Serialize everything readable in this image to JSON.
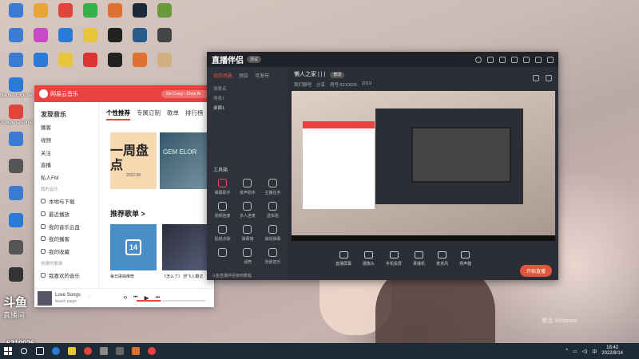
{
  "desktop": {
    "icons": [
      {
        "label": "",
        "color": "#3b7bd4"
      },
      {
        "label": "",
        "color": "#e8a53a"
      },
      {
        "label": "",
        "color": "#e0453a"
      },
      {
        "label": "",
        "color": "#34b24a"
      },
      {
        "label": "",
        "color": "#e07030"
      },
      {
        "label": "",
        "color": "#1b2838"
      },
      {
        "label": "",
        "color": "#6a9a3a"
      },
      {
        "label": "",
        "color": "#3b7bd4"
      },
      {
        "label": "",
        "color": "#c94ac9"
      },
      {
        "label": "",
        "color": "#2a7ad8"
      },
      {
        "label": "",
        "color": "#e8c53a"
      },
      {
        "label": "",
        "color": "#222"
      },
      {
        "label": "",
        "color": "#2a5a8a"
      },
      {
        "label": "",
        "color": "#444"
      },
      {
        "label": "",
        "color": "#3b7bd4"
      },
      {
        "label": "",
        "color": "#2a7ad8"
      },
      {
        "label": "",
        "color": "#e8c53a"
      },
      {
        "label": "",
        "color": "#d33"
      },
      {
        "label": "",
        "color": "#222"
      },
      {
        "label": "",
        "color": "#e07030"
      },
      {
        "label": "",
        "color": "#d0b080"
      },
      {
        "label": "Internet Explorer",
        "color": "#2a7ad8"
      },
      {
        "label": "Google Chrome",
        "color": "#e0453a"
      },
      {
        "label": "",
        "color": "#3b7bd4"
      },
      {
        "label": "",
        "color": "#555"
      },
      {
        "label": "",
        "color": "#3b7bd4"
      },
      {
        "label": "",
        "color": "#2a7ad8"
      },
      {
        "label": "",
        "color": "#555"
      },
      {
        "label": "",
        "color": "#333"
      }
    ],
    "watermark": "斗鱼",
    "room": "直播间",
    "room_id": "6210026",
    "activate": "激活 Windows"
  },
  "netease": {
    "title": "网易云音乐",
    "search_placeholder": "Go Crazy - Chris Br",
    "side_items": [
      "发现音乐",
      "播客",
      "视频",
      "关注",
      "直播",
      "私人FM"
    ],
    "my_music": "我的音乐",
    "my_items": [
      "本地与下载",
      "最近播放",
      "我的音乐云盘",
      "我的播客",
      "我的收藏"
    ],
    "created": "创建的歌单",
    "liked": "我喜欢的音乐",
    "tabs": [
      "个性推荐",
      "专属订制",
      "歌单",
      "排行榜"
    ],
    "banner_text": "一周盘点",
    "banner_date": "2022.08",
    "banner2_text": "GEM ELOR",
    "section": "推荐歌单 >",
    "card1_day": "14",
    "card1_caption": "每日歌曲推荐",
    "card2_caption": "《怎么了》 舒飞人霸达",
    "song": "Love Songs",
    "artist": "kaash paige",
    "time_left": "00:07",
    "time_right": "02:56"
  },
  "app": {
    "title": "直播伴侣",
    "badge": "测试",
    "left_tabs": [
      "我的场景",
      "预告",
      "可发布"
    ],
    "scenes": [
      "场景名",
      "场景1",
      "桌面1"
    ],
    "tools_title": "工具箱",
    "tools": [
      "弹幕助手",
      "变声助手",
      "主播任务",
      "视频连麦",
      "多人连麦",
      "送体验",
      "贴纸点歌",
      "弹幕墙",
      "滚动弹幕",
      "",
      "话筒",
      "背景音乐"
    ],
    "hint": "斗鱼直播伴侣使用教程",
    "room_title": "懒人之家 | | |",
    "room_tag": "修改",
    "category": "我们聊吧",
    "sub": "分享",
    "room_no": "房号:6210026",
    "fans": "2019",
    "bottom": [
      "直播屏幕",
      "摄像头",
      "手机投屏",
      "录播机",
      "麦克风",
      "扬声器"
    ],
    "start": "开始直播",
    "timer": "00:00:00"
  },
  "taskbar": {
    "time": "18:42",
    "date": "2022/8/14",
    "lang": "中"
  }
}
